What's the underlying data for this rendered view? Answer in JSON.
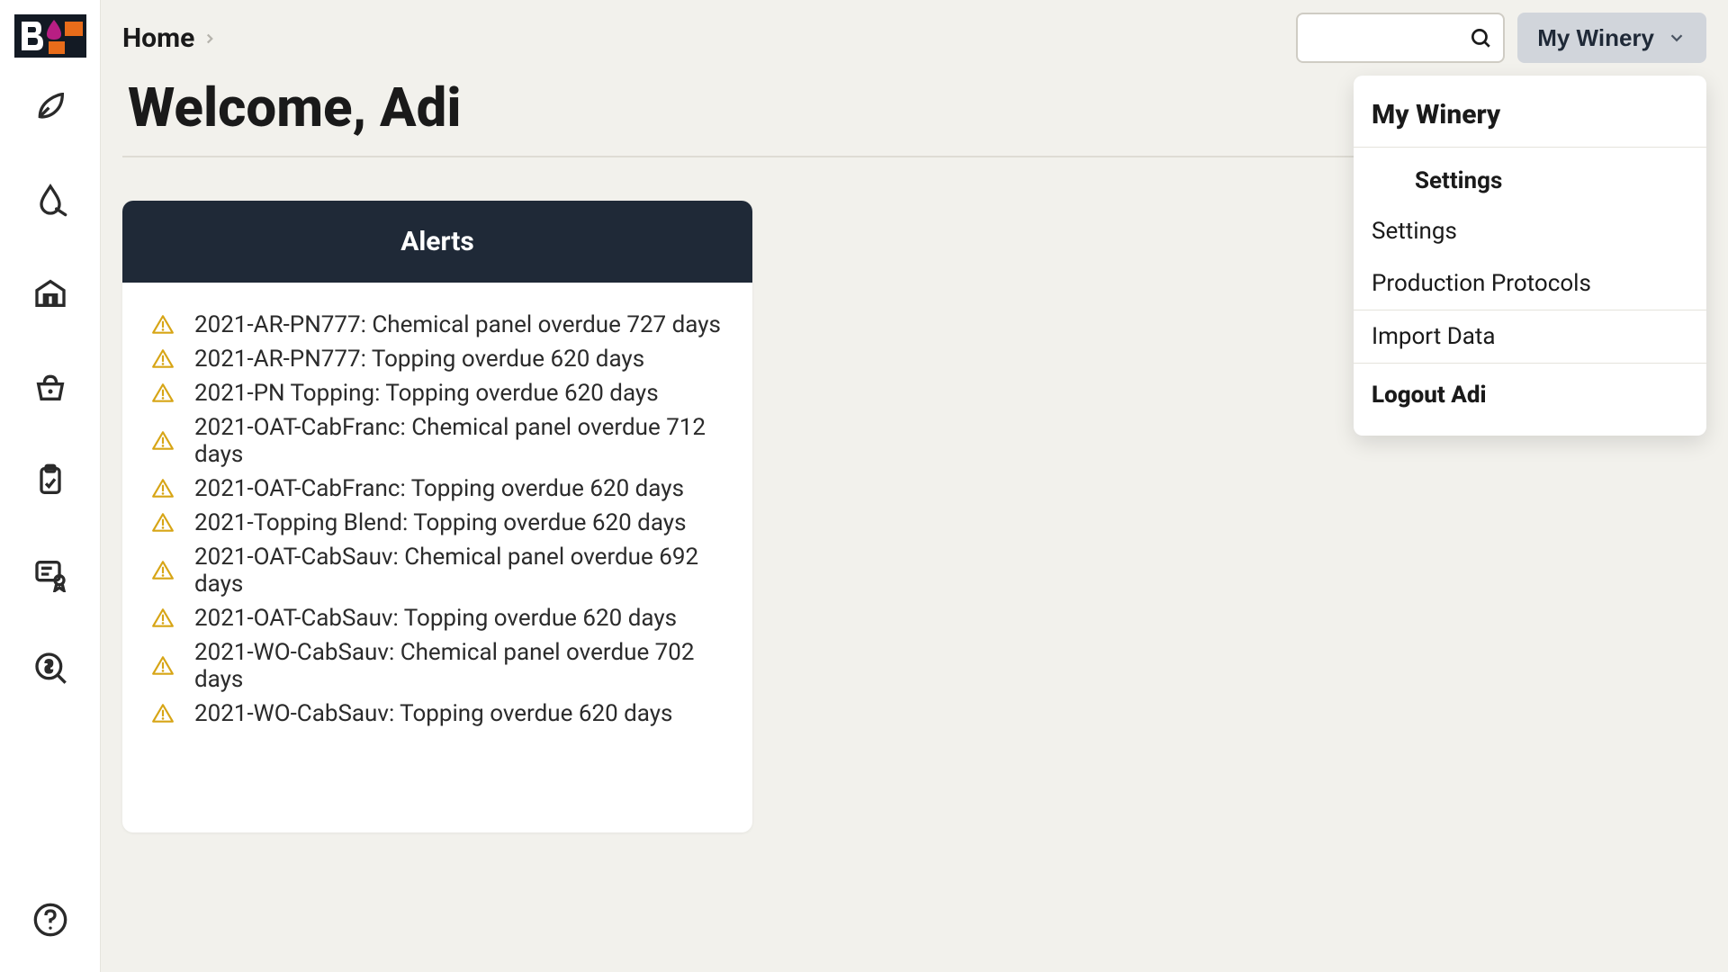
{
  "header": {
    "breadcrumb": "Home",
    "page_title": "Welcome, Adi",
    "search_placeholder": "",
    "winery_label": "My Winery"
  },
  "sidebar": {
    "items": [
      {
        "name": "leaf"
      },
      {
        "name": "drop"
      },
      {
        "name": "warehouse"
      },
      {
        "name": "basket"
      },
      {
        "name": "clipboard"
      },
      {
        "name": "certificate"
      },
      {
        "name": "money-search"
      }
    ]
  },
  "dropdown": {
    "title": "My Winery",
    "section_label": "Settings",
    "items": {
      "settings": "Settings",
      "protocols": "Production Protocols",
      "import": "Import Data",
      "logout": "Logout Adi"
    }
  },
  "alerts": {
    "title": "Alerts",
    "rows": [
      "2021-AR-PN777: Chemical panel overdue 727 days",
      "2021-AR-PN777: Topping overdue 620 days",
      "2021-PN Topping: Topping overdue 620 days",
      "2021-OAT-CabFranc: Chemical panel overdue 712 days",
      "2021-OAT-CabFranc: Topping overdue 620 days",
      "2021-Topping Blend: Topping overdue 620 days",
      "2021-OAT-CabSauv: Chemical panel overdue 692 days",
      "2021-OAT-CabSauv: Topping overdue 620 days",
      "2021-WO-CabSauv: Chemical panel overdue 702 days",
      "2021-WO-CabSauv: Topping overdue 620 days"
    ]
  }
}
